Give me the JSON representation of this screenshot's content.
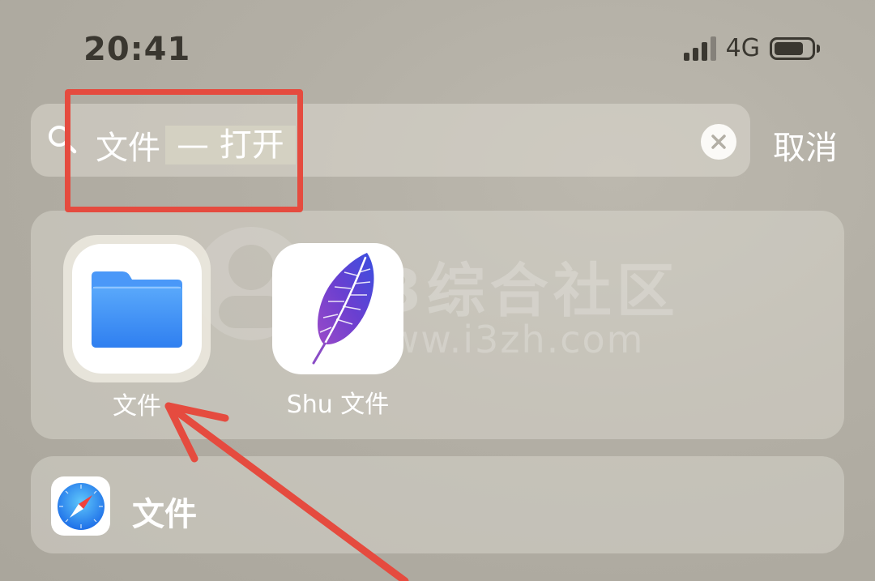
{
  "status_bar": {
    "time": "20:41",
    "network": "4G",
    "battery_level": 0.8
  },
  "search": {
    "query": "文件",
    "suggestion": "— 打开",
    "cancel_label": "取消",
    "icon": "search-icon",
    "clear_icon": "clear-icon"
  },
  "apps": [
    {
      "label": "文件",
      "icon": "files-folder-icon"
    },
    {
      "label": "Shu 文件",
      "icon": "shu-feather-icon"
    }
  ],
  "web_result": {
    "label": "文件",
    "icon": "safari-compass-icon"
  },
  "watermark": {
    "text": "i3综合社区",
    "url": "www.i3zh.com"
  },
  "colors": {
    "annotation_red": "#e54b3f",
    "folder_blue": "#3a8ef6",
    "feather_purple": "#6a3fd0"
  }
}
